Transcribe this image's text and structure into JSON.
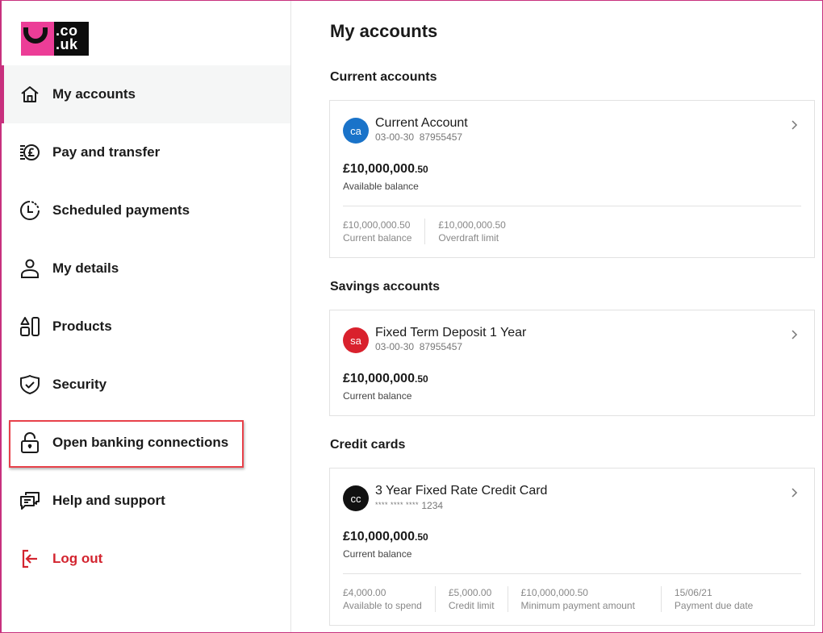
{
  "brand": {
    "logo_line1": ".co",
    "logo_line2": ".uk",
    "accent_color": "#c8307e",
    "logo_pink": "#ec3d97"
  },
  "sidebar": {
    "items": [
      {
        "label": "My accounts",
        "icon": "home-icon",
        "active": true
      },
      {
        "label": "Pay and transfer",
        "icon": "pound-coin-icon"
      },
      {
        "label": "Scheduled payments",
        "icon": "clock-icon"
      },
      {
        "label": "My details",
        "icon": "person-icon"
      },
      {
        "label": "Products",
        "icon": "products-icon"
      },
      {
        "label": "Security",
        "icon": "shield-check-icon"
      },
      {
        "label": "Open banking connections",
        "icon": "unlocked-padlock-icon",
        "highlighted": true
      },
      {
        "label": "Help and support",
        "icon": "chat-bubbles-icon"
      },
      {
        "label": "Log out",
        "icon": "logout-icon",
        "color": "#d3242f"
      }
    ]
  },
  "main": {
    "title": "My accounts",
    "sections": [
      {
        "title": "Current accounts",
        "cards": [
          {
            "badge": "ca",
            "badge_color": "#1a73c9",
            "name": "Current Account",
            "number": "03-00-30  87955457",
            "balance_main": "£10,000,000",
            "balance_pence": ".50",
            "balance_label": "Available balance",
            "stats": [
              {
                "value": "£10,000,000.50",
                "label": "Current balance"
              },
              {
                "value": "£10,000,000.50",
                "label": "Overdraft limit"
              }
            ]
          }
        ]
      },
      {
        "title": "Savings accounts",
        "cards": [
          {
            "badge": "sa",
            "badge_color": "#d9212d",
            "name": "Fixed Term Deposit 1 Year",
            "number": "03-00-30  87955457",
            "balance_main": "£10,000,000",
            "balance_pence": ".50",
            "balance_label": "Current balance"
          }
        ]
      },
      {
        "title": "Credit cards",
        "cards": [
          {
            "badge": "cc",
            "badge_color": "#111111",
            "name": "3 Year Fixed Rate Credit Card",
            "number_masked": "**** **** ****",
            "number_last": "1234",
            "balance_main": "£10,000,000",
            "balance_pence": ".50",
            "balance_label": "Current balance",
            "stats": [
              {
                "value": "£4,000.00",
                "label": "Available to spend"
              },
              {
                "value": "£5,000.00",
                "label": "Credit limit"
              },
              {
                "value": "£10,000,000.50",
                "label": "Minimum payment amount"
              },
              {
                "value": "15/06/21",
                "label": "Payment due date"
              }
            ]
          }
        ]
      }
    ]
  }
}
